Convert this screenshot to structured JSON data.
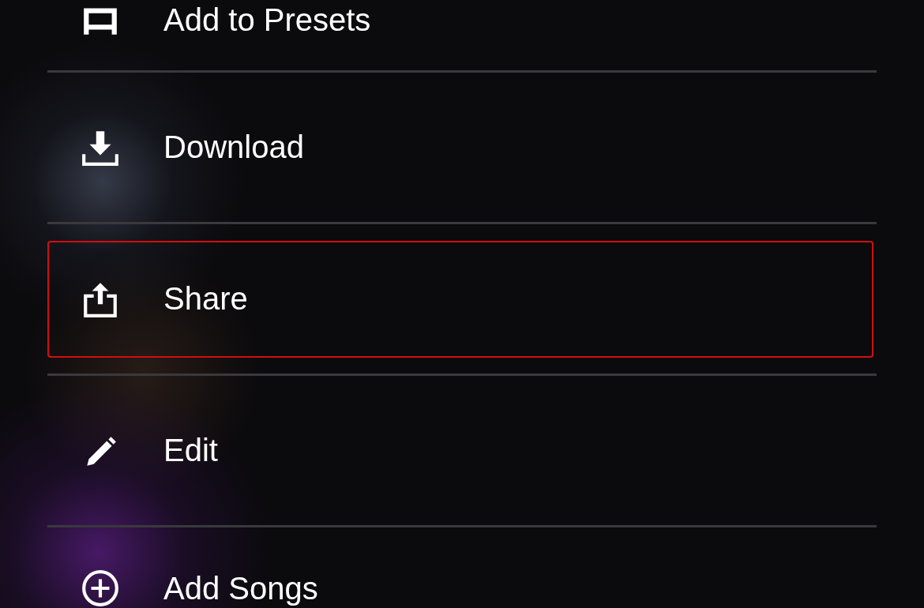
{
  "menu_items": [
    {
      "label": "Add to Presets",
      "kind": "presets",
      "selected": false
    },
    {
      "label": "Download",
      "kind": "download",
      "selected": false
    },
    {
      "label": "Share",
      "kind": "share",
      "selected": true
    },
    {
      "label": "Edit",
      "kind": "edit",
      "selected": false
    },
    {
      "label": "Add Songs",
      "kind": "add",
      "selected": false
    }
  ]
}
